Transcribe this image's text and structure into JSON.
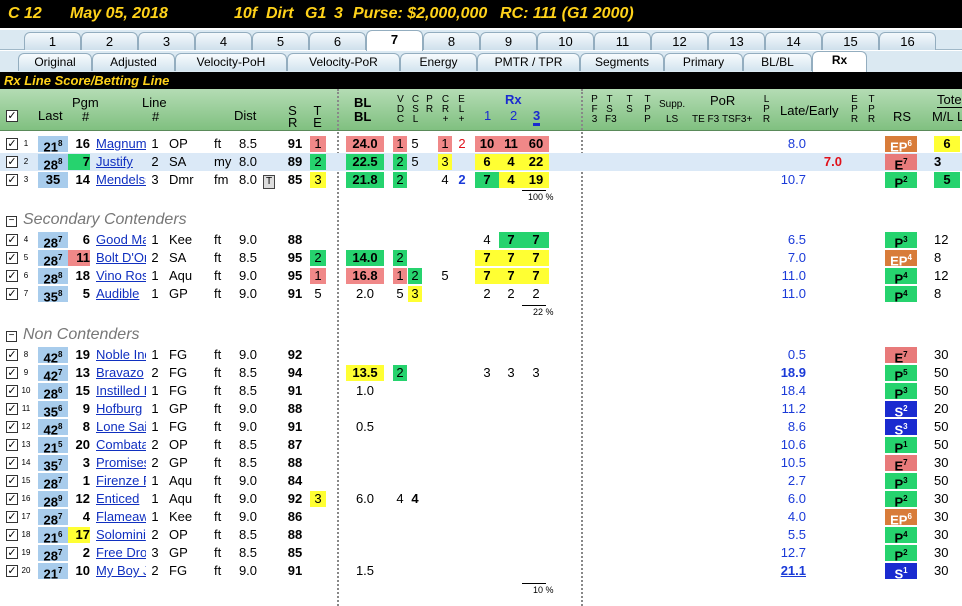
{
  "header": {
    "race": "C 12",
    "date": "May 05, 2018",
    "dist": "10f",
    "surface": "Dirt",
    "grade": "G1",
    "num": "3",
    "purse": "Purse: $2,000,000",
    "rc": "RC: 111 (G1 2000)"
  },
  "race_tabs": [
    "1",
    "2",
    "3",
    "4",
    "5",
    "6",
    "7",
    "8",
    "9",
    "10",
    "11",
    "12",
    "13",
    "14",
    "15",
    "16"
  ],
  "race_tab_active": "7",
  "view_tabs": [
    "Original",
    "Adjusted",
    "Velocity-PoH",
    "Velocity-PoR",
    "Energy",
    "PMTR / TPR",
    "Segments",
    "Primary",
    "BL/BL",
    "Rx"
  ],
  "view_tab_active": "Rx",
  "section_title": "Rx Line Score/Betting Line",
  "columns": {
    "last": "Last",
    "pgm": "Pgm",
    "pgm2": "#",
    "line": "Line",
    "line2": "#",
    "dist": "Dist",
    "sr1": "S",
    "sr2": "R",
    "te1": "T",
    "te2": "E",
    "bl1": "BL",
    "bl2": "BL",
    "rx": "Rx",
    "rx1": "1",
    "rx2": "2",
    "rx3": "3",
    "supp": "Supp.",
    "ls": "LS",
    "por": "PoR",
    "tef3": "TE F3",
    "tsf3": "TSF3+",
    "late": "Late/Early",
    "rs": "RS",
    "tote": "Tote",
    "ml": "M/L",
    "u": "L"
  },
  "groups": {
    "secondary": "Secondary Contenders",
    "non": "Non Contenders"
  },
  "pct": {
    "contenders": "100 %",
    "secondary": "22 %",
    "non": "10 %"
  },
  "rows": [
    {
      "n": "1",
      "last": "21",
      "lsup": "8",
      "pgm": "16",
      "name": "Magnum",
      "line": "1",
      "trk": "OP",
      "cond": "ft",
      "dist": "8.5",
      "sr": "91",
      "te": "1",
      "bl": "24.0",
      "v": "1",
      "d": "5",
      "c": "",
      "e1": "1",
      "e2": "2",
      "rx1": "10",
      "rx2": "11",
      "rx3": "60",
      "late": "8.0",
      "rs": "EP",
      "rssup": "6",
      "ml": "6"
    },
    {
      "n": "2",
      "last": "28",
      "lsup": "8",
      "pgm": "7",
      "name": "Justify",
      "line": "2",
      "trk": "SA",
      "cond": "my",
      "dist": "8.0",
      "sr": "89",
      "te": "2",
      "bl": "22.5",
      "v": "2",
      "d": "5",
      "c": "3",
      "rx1": "6",
      "rx2": "4",
      "rx3": "22",
      "late": "7.0",
      "rs": "E",
      "rssup": "7",
      "ml": "3"
    },
    {
      "n": "3",
      "last": "35",
      "lsup": "",
      "pgm": "14",
      "name": "Mendelssohn",
      "line": "3",
      "trk": "Dmr",
      "cond": "fm",
      "dist": "8.0",
      "sr": "85",
      "te": "3",
      "bl": "21.8",
      "v": "2",
      "e1": "4",
      "e2": "2",
      "rx1": "7",
      "rx2": "4",
      "rx3": "19",
      "late": "10.7",
      "rs": "P",
      "rssup": "2",
      "ml": "5"
    },
    {
      "n": "4",
      "last": "28",
      "lsup": "7",
      "pgm": "6",
      "name": "Good Magic",
      "line": "1",
      "trk": "Kee",
      "cond": "ft",
      "dist": "9.0",
      "sr": "88",
      "rx1": "4",
      "rx2": "7",
      "rx3": "7",
      "late": "6.5",
      "rs": "P",
      "rssup": "3",
      "ml": "12"
    },
    {
      "n": "5",
      "last": "28",
      "lsup": "7",
      "pgm": "11",
      "name": "Bolt D'Oro",
      "line": "2",
      "trk": "SA",
      "cond": "ft",
      "dist": "8.5",
      "sr": "95",
      "te": "2",
      "bl": "14.0",
      "v": "2",
      "rx1": "7",
      "rx2": "7",
      "rx3": "7",
      "late": "7.0",
      "rs": "EP",
      "rssup": "4",
      "ml": "8"
    },
    {
      "n": "6",
      "last": "28",
      "lsup": "8",
      "pgm": "18",
      "name": "Vino Rosso",
      "line": "1",
      "trk": "Aqu",
      "cond": "ft",
      "dist": "9.0",
      "sr": "95",
      "te": "1",
      "bl": "16.8",
      "v": "1",
      "d": "2",
      "c": "5",
      "rx1": "7",
      "rx2": "7",
      "rx3": "7",
      "late": "11.0",
      "rs": "P",
      "rssup": "4",
      "ml": "12"
    },
    {
      "n": "7",
      "last": "35",
      "lsup": "8",
      "pgm": "5",
      "name": "Audible",
      "line": "1",
      "trk": "GP",
      "cond": "ft",
      "dist": "9.0",
      "sr": "91",
      "te": "5",
      "bl": "2.0",
      "v": "5",
      "d": "3",
      "rx1": "2",
      "rx2": "2",
      "rx3": "2",
      "late": "11.0",
      "rs": "P",
      "rssup": "4",
      "ml": "8"
    },
    {
      "n": "8",
      "last": "42",
      "lsup": "8",
      "pgm": "19",
      "name": "Noble Indy",
      "line": "1",
      "trk": "FG",
      "cond": "ft",
      "dist": "9.0",
      "sr": "92",
      "late": "0.5",
      "rs": "E",
      "rssup": "7",
      "ml": "30"
    },
    {
      "n": "9",
      "last": "42",
      "lsup": "7",
      "pgm": "13",
      "name": "Bravazo",
      "line": "2",
      "trk": "FG",
      "cond": "ft",
      "dist": "8.5",
      "sr": "94",
      "bl": "13.5",
      "v": "2",
      "rx1": "3",
      "rx2": "3",
      "rx3": "3",
      "late": "18.9",
      "rs": "P",
      "rssup": "5",
      "ml": "50"
    },
    {
      "n": "10",
      "last": "28",
      "lsup": "6",
      "pgm": "15",
      "name": "Instilled Regard",
      "line": "1",
      "trk": "FG",
      "cond": "ft",
      "dist": "8.5",
      "sr": "91",
      "bl": "1.0",
      "late": "18.4",
      "rs": "P",
      "rssup": "3",
      "ml": "50"
    },
    {
      "n": "11",
      "last": "35",
      "lsup": "6",
      "pgm": "9",
      "name": "Hofburg",
      "line": "1",
      "trk": "GP",
      "cond": "ft",
      "dist": "9.0",
      "sr": "88",
      "late": "11.2",
      "rs": "S",
      "rssup": "2",
      "ml": "20"
    },
    {
      "n": "12",
      "last": "42",
      "lsup": "8",
      "pgm": "8",
      "name": "Lone Sailor",
      "line": "1",
      "trk": "FG",
      "cond": "ft",
      "dist": "9.0",
      "sr": "91",
      "bl": "0.5",
      "late": "8.6",
      "rs": "S",
      "rssup": "3",
      "ml": "50"
    },
    {
      "n": "13",
      "last": "21",
      "lsup": "5",
      "pgm": "20",
      "name": "Combatant",
      "line": "2",
      "trk": "OP",
      "cond": "ft",
      "dist": "8.5",
      "sr": "87",
      "late": "10.6",
      "rs": "P",
      "rssup": "1",
      "ml": "50"
    },
    {
      "n": "14",
      "last": "35",
      "lsup": "7",
      "pgm": "3",
      "name": "Promises Fulfilled",
      "line": "2",
      "trk": "GP",
      "cond": "ft",
      "dist": "8.5",
      "sr": "88",
      "late": "10.5",
      "rs": "E",
      "rssup": "7",
      "ml": "30"
    },
    {
      "n": "15",
      "last": "28",
      "lsup": "7",
      "pgm": "1",
      "name": "Firenze Fire",
      "line": "1",
      "trk": "Aqu",
      "cond": "ft",
      "dist": "9.0",
      "sr": "84",
      "late": "2.7",
      "rs": "P",
      "rssup": "3",
      "ml": "50"
    },
    {
      "n": "16",
      "last": "28",
      "lsup": "9",
      "pgm": "12",
      "name": "Enticed",
      "line": "1",
      "trk": "Aqu",
      "cond": "ft",
      "dist": "9.0",
      "sr": "92",
      "te": "3",
      "bl": "6.0",
      "v": "4",
      "d": "4",
      "late": "6.0",
      "rs": "P",
      "rssup": "2",
      "ml": "30"
    },
    {
      "n": "17",
      "last": "28",
      "lsup": "7",
      "pgm": "4",
      "name": "Flameaway",
      "line": "1",
      "trk": "Kee",
      "cond": "ft",
      "dist": "9.0",
      "sr": "86",
      "late": "4.0",
      "rs": "EP",
      "rssup": "6",
      "ml": "30"
    },
    {
      "n": "18",
      "last": "21",
      "lsup": "6",
      "pgm": "17",
      "name": "Solomini",
      "line": "2",
      "trk": "OP",
      "cond": "ft",
      "dist": "8.5",
      "sr": "88",
      "late": "5.5",
      "rs": "P",
      "rssup": "4",
      "ml": "30"
    },
    {
      "n": "19",
      "last": "28",
      "lsup": "7",
      "pgm": "2",
      "name": "Free Drop Billy",
      "line": "3",
      "trk": "GP",
      "cond": "ft",
      "dist": "8.5",
      "sr": "85",
      "late": "12.7",
      "rs": "P",
      "rssup": "2",
      "ml": "30"
    },
    {
      "n": "20",
      "last": "21",
      "lsup": "7",
      "pgm": "10",
      "name": "My Boy Jack",
      "line": "2",
      "trk": "FG",
      "cond": "ft",
      "dist": "9.0",
      "sr": "91",
      "bl": "1.5",
      "late": "21.1",
      "rs": "S",
      "rssup": "1",
      "ml": "30"
    }
  ],
  "colors": {
    "title_bg": "#000000",
    "title_fg": "#ffd21a",
    "header_green": "#80c080",
    "cell_red": "#f08888",
    "cell_green": "#26d36e",
    "cell_yellow": "#ffff33",
    "last_blue": "#a8ccec"
  }
}
